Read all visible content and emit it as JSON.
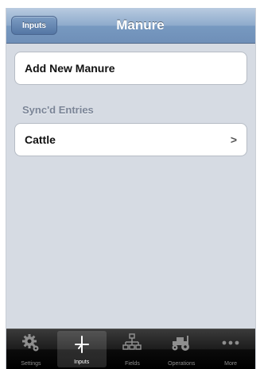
{
  "navbar": {
    "back_label": "Inputs",
    "title": "Manure"
  },
  "actions": {
    "add_new_label": "Add New Manure"
  },
  "section": {
    "header": "Sync'd Entries",
    "entries": [
      {
        "label": "Cattle",
        "chevron": ">"
      }
    ]
  },
  "tabbar": {
    "active_tab": "Inputs",
    "tabs": [
      {
        "label": "Settings",
        "icon": "gear-icon"
      },
      {
        "label": "Inputs",
        "icon": "inputs-icon"
      },
      {
        "label": "Fields",
        "icon": "fields-hierarchy-icon"
      },
      {
        "label": "Operations",
        "icon": "tractor-icon"
      },
      {
        "label": "More",
        "icon": "more-dots-icon"
      }
    ]
  },
  "colors": {
    "navbar": "#7f9fc4",
    "background": "#d6dbe3",
    "tabbar": "#111111"
  }
}
